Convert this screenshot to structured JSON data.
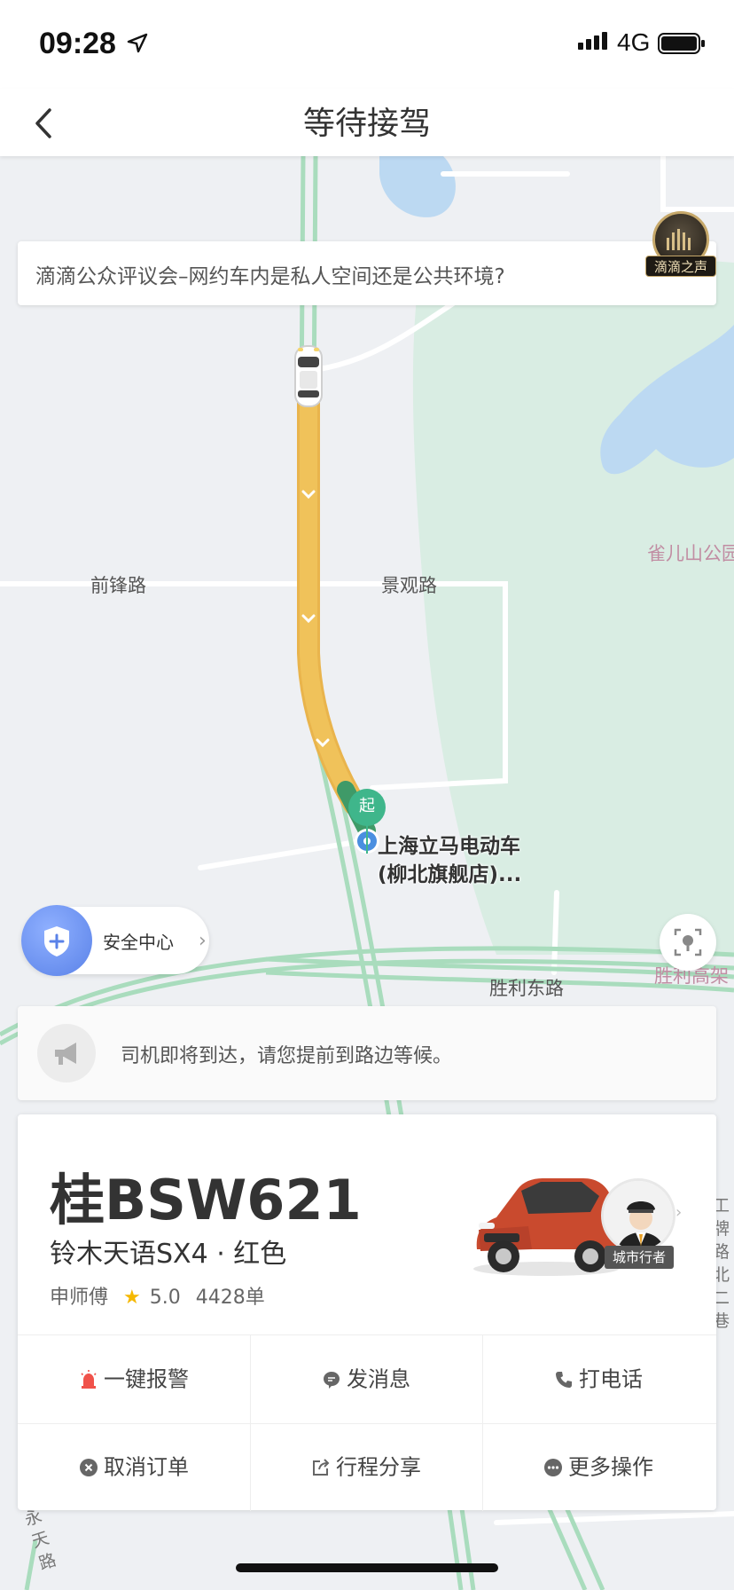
{
  "status_bar": {
    "time": "09:28",
    "network": "4G"
  },
  "nav": {
    "title": "等待接驾"
  },
  "map": {
    "announcement": "滴滴公众评议会–网约车内是私人空间还是公共环境?",
    "voice_badge": "滴滴之声",
    "road_labels": {
      "qianfeng": "前锋路",
      "jingguan": "景观路",
      "shengli_east": "胜利东路",
      "shengli_elevated": "胜利高架",
      "park": "雀儿山公园",
      "vertical_right": "工牌路北二巷",
      "bottom_left": "永天路"
    },
    "start_pin": "起",
    "start_place_line1": "上海立马电动车",
    "start_place_line2": "(柳北旗舰店)...",
    "safety_center": "安全中心"
  },
  "notice": {
    "text": "司机即将到达，请您提前到路边等候。"
  },
  "driver_card": {
    "plate": "桂BSW621",
    "car_model": "铃木天语SX4 · 红色",
    "driver_name": "申师傅",
    "rating": "5.0",
    "orders": "4428单",
    "driver_tag": "城市行者"
  },
  "actions": {
    "alarm": "一键报警",
    "message": "发消息",
    "call": "打电话",
    "cancel": "取消订单",
    "share": "行程分享",
    "more": "更多操作"
  },
  "colors": {
    "route": "#f0c25a",
    "road_green": "#9fd8b5",
    "park_green": "#d9ede3",
    "water": "#bcd9f2",
    "accent_blue": "#5a82e8",
    "start_green": "#3fb68b"
  }
}
